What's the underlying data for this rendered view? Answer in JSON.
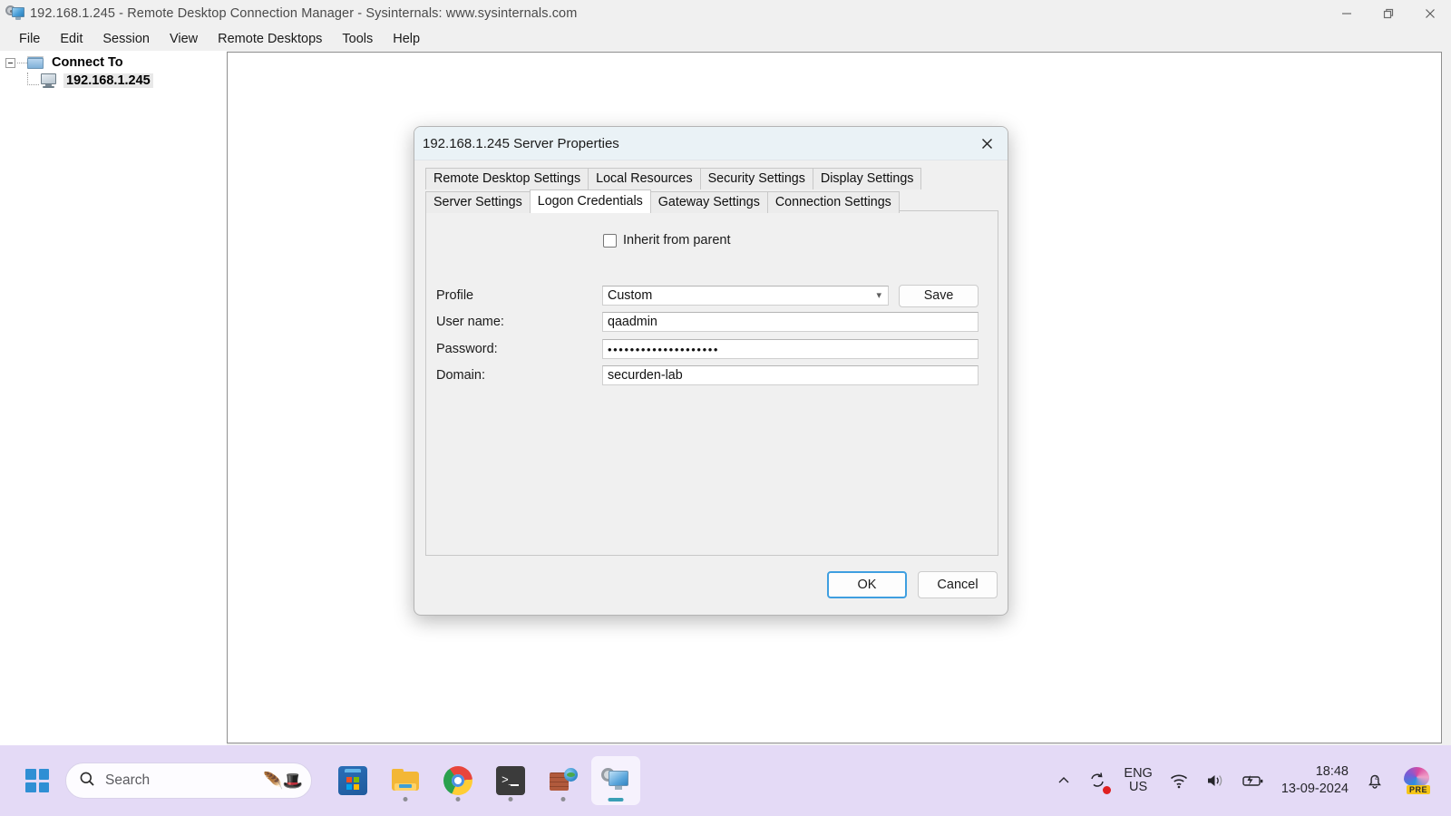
{
  "window": {
    "title": "192.168.1.245 - Remote Desktop Connection Manager - Sysinternals: www.sysinternals.com",
    "app_icon": "rdcman-icon",
    "controls": {
      "minimize": "minimize-icon",
      "restore": "restore-icon",
      "close": "close-icon"
    }
  },
  "menubar": {
    "items": [
      {
        "label": "File"
      },
      {
        "label": "Edit"
      },
      {
        "label": "Session"
      },
      {
        "label": "View"
      },
      {
        "label": "Remote Desktops"
      },
      {
        "label": "Tools"
      },
      {
        "label": "Help"
      }
    ]
  },
  "tree": {
    "root": {
      "label": "Connect To",
      "icon": "folder-icon",
      "expanded": true
    },
    "child": {
      "label": "192.168.1.245",
      "icon": "computer-icon",
      "selected": true
    }
  },
  "dialog": {
    "title": "192.168.1.245 Server Properties",
    "close_icon": "close-icon",
    "tabs_row1": [
      {
        "label": "Remote Desktop Settings",
        "selected": false
      },
      {
        "label": "Local Resources",
        "selected": false
      },
      {
        "label": "Security Settings",
        "selected": false
      },
      {
        "label": "Display Settings",
        "selected": false
      }
    ],
    "tabs_row2": [
      {
        "label": "Server Settings",
        "selected": false
      },
      {
        "label": "Logon Credentials",
        "selected": true
      },
      {
        "label": "Gateway Settings",
        "selected": false
      },
      {
        "label": "Connection Settings",
        "selected": false
      }
    ],
    "form": {
      "inherit": {
        "label": "Inherit from parent",
        "checked": false
      },
      "profile": {
        "label": "Profile",
        "value": "Custom",
        "chevron": "chevron-down-icon"
      },
      "save_label": "Save",
      "username": {
        "label": "User name:",
        "value": "qaadmin"
      },
      "password": {
        "label": "Password:",
        "value": "••••••••••••••••••••"
      },
      "domain": {
        "label": "Domain:",
        "value": "securden-lab"
      }
    },
    "buttons": {
      "ok": "OK",
      "cancel": "Cancel"
    }
  },
  "taskbar": {
    "start": "windows-start-icon",
    "search": {
      "placeholder": "Search",
      "icon": "search-icon",
      "emojis": "🪶🎩"
    },
    "apps": [
      {
        "name": "microsoft-store",
        "running": false,
        "active": false
      },
      {
        "name": "file-explorer",
        "running": true,
        "active": false
      },
      {
        "name": "google-chrome",
        "running": true,
        "active": false
      },
      {
        "name": "windows-terminal",
        "running": true,
        "active": false
      },
      {
        "name": "firewall-app",
        "running": true,
        "active": false
      },
      {
        "name": "rdcman",
        "running": true,
        "active": true
      }
    ],
    "tray": {
      "overflow": "chevron-up-icon",
      "sync": "sync-status-icon",
      "language": {
        "line1": "ENG",
        "line2": "US"
      },
      "wifi": "wifi-icon",
      "volume": "volume-icon",
      "battery": "battery-charging-icon",
      "clock": {
        "time": "18:48",
        "date": "13-09-2024"
      },
      "notifications": "notification-bell-icon",
      "copilot": {
        "icon": "copilot-icon",
        "badge": "PRE"
      }
    }
  },
  "colors": {
    "taskbar_bg": "#e4daf6",
    "dialog_titlebar": "#eaf2f6",
    "focus_blue": "#3f9fe0",
    "accent_blue": "#2f8fd4"
  }
}
